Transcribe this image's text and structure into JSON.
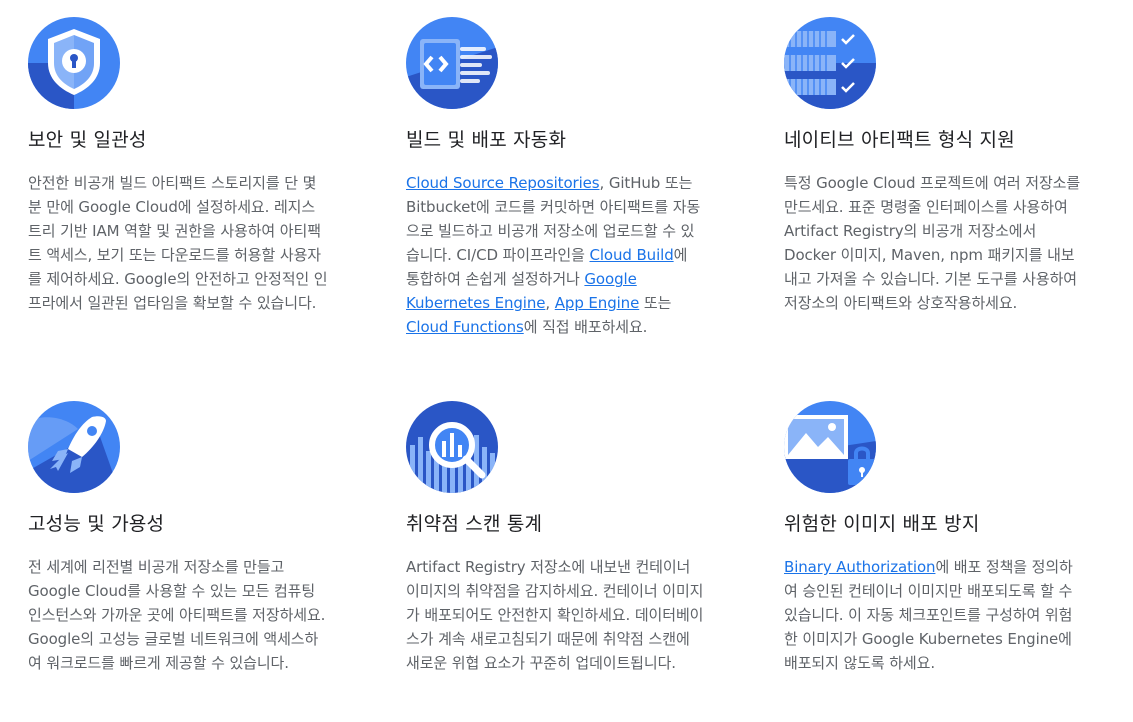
{
  "colors": {
    "icon_dark": "#2a56c6",
    "icon_mid": "#4285f4",
    "icon_light": "#8ab4f8",
    "heading": "#202124",
    "body_text": "#5f6368",
    "link": "#1a73e8"
  },
  "features": [
    {
      "icon": "shield-lock-icon",
      "title": "보안 및 일관성",
      "text": "안전한 비공개 빌드 아티팩트 스토리지를 단 몇 분 만에 Google Cloud에 설정하세요. 레지스트리 기반 IAM 역할 및 권한을 사용하여 아티팩트 액세스, 보기 또는 다운로드를 허용할 사용자를 제어하세요. Google의 안전하고 안정적인 인프라에서 일관된 업타임을 확보할 수 있습니다."
    },
    {
      "icon": "code-build-icon",
      "title": "빌드 및 배포 자동화",
      "link_source_repos": "Cloud Source Repositories",
      "text_a": ", GitHub 또는 Bitbucket에 코드를 커밋하면 아티팩트를 자동으로 빌드하고 비공개 저장소에 업로드할 수 있습니다. CI/CD 파이프라인을 ",
      "link_cloud_build": "Cloud Build",
      "text_b": "에 통합하여 손쉽게 설정하거나 ",
      "link_gke": "Google Kubernetes Engine",
      "text_c": ", ",
      "link_app_engine": "App Engine",
      "text_d": " 또는 ",
      "link_functions": "Cloud Functions",
      "text_e": "에 직접 배포하세요."
    },
    {
      "icon": "server-checklist-icon",
      "title": "네이티브 아티팩트 형식 지원",
      "text": "특정 Google Cloud 프로젝트에 여러 저장소를 만드세요. 표준 명령줄 인터페이스를 사용하여 Artifact Registry의 비공개 저장소에서 Docker 이미지, Maven, npm 패키지를 내보내고 가져올 수 있습니다. 기본 도구를 사용하여 저장소의 아티팩트와 상호작용하세요."
    },
    {
      "icon": "rocket-icon",
      "title": "고성능 및 가용성",
      "text": "전 세계에 리전별 비공개 저장소를 만들고 Google Cloud를 사용할 수 있는 모든 컴퓨팅 인스턴스와 가까운 곳에 아티팩트를 저장하세요. Google의 고성능 글로벌 네트워크에 액세스하여 워크로드를 빠르게 제공할 수 있습니다."
    },
    {
      "icon": "scan-magnifier-icon",
      "title": "취약점 스캔 통계",
      "text": "Artifact Registry 저장소에 내보낸 컨테이너 이미지의 취약점을 감지하세요. 컨테이너 이미지가 배포되어도 안전한지 확인하세요. 데이터베이스가 계속 새로고침되기 때문에 취약점 스캔에 새로운 위협 요소가 꾸준히 업데이트됩니다."
    },
    {
      "icon": "image-lock-icon",
      "title": "위험한 이미지 배포 방지",
      "link_binary_auth": "Binary Authorization",
      "text_a": "에 배포 정책을 정의하여 승인된 컨테이너 이미지만 배포되도록 할 수 있습니다. 이 자동 체크포인트를 구성하여 위험한 이미지가 Google Kubernetes Engine에 배포되지 않도록 하세요."
    }
  ]
}
